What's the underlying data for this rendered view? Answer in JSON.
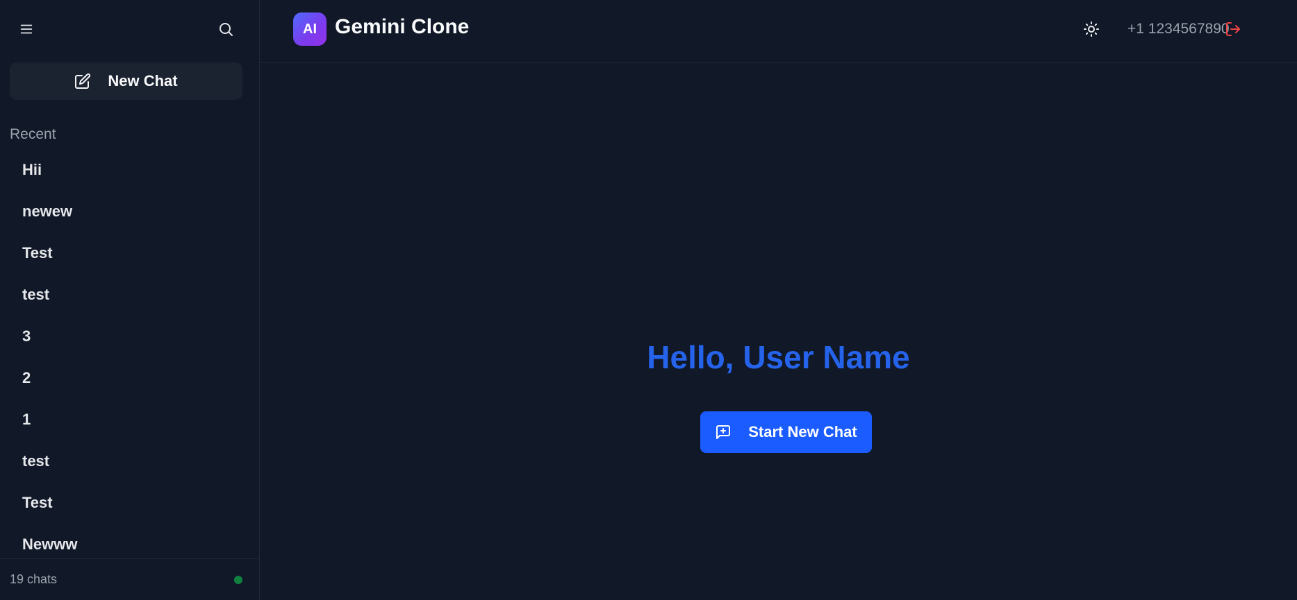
{
  "sidebar": {
    "new_chat_label": "New Chat",
    "recent_label": "Recent",
    "chats": [
      "Hii",
      "newew",
      "Test",
      "test",
      "3",
      "2",
      "1",
      "test",
      "Test",
      "Newww"
    ],
    "footer_count": "19 chats"
  },
  "header": {
    "logo_text": "AI",
    "title": "Gemini Clone",
    "phone": "+1 1234567890"
  },
  "main": {
    "greeting": "Hello, User Name",
    "start_button_label": "Start New Chat"
  },
  "colors": {
    "background": "#111827",
    "accent": "#2563eb",
    "button": "#1a5cff",
    "logout": "#ef4444",
    "status": "#10803f"
  },
  "icons": [
    "menu-icon",
    "search-icon",
    "edit-icon",
    "sun-icon",
    "logout-icon",
    "message-plus-icon"
  ]
}
